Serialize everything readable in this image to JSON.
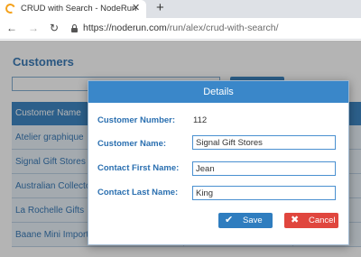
{
  "browser": {
    "tab_title": "CRUD with Search - NodeRun",
    "tab_close": "✕",
    "new_tab": "+",
    "url_host": "https://noderun.com",
    "url_path": "/run/alex/crud-with-search/"
  },
  "page": {
    "title": "Customers",
    "grid": {
      "header": "Customer Name",
      "rows": [
        "Atelier graphique",
        "Signal Gift Stores",
        "Australian Collectors",
        "La Rochelle Gifts",
        "Baane Mini Imports"
      ]
    }
  },
  "dialog": {
    "title": "Details",
    "customer_number_label": "Customer Number:",
    "customer_number": "112",
    "customer_name_label": "Customer Name:",
    "customer_name": "Signal Gift Stores",
    "contact_first_label": "Contact First Name:",
    "contact_first": "Jean",
    "contact_last_label": "Contact Last Name:",
    "contact_last": "King",
    "save_label": "Save",
    "cancel_label": "Cancel"
  },
  "colors": {
    "accent": "#2f7dbf",
    "header": "#3a87c9",
    "danger": "#e0463e"
  }
}
